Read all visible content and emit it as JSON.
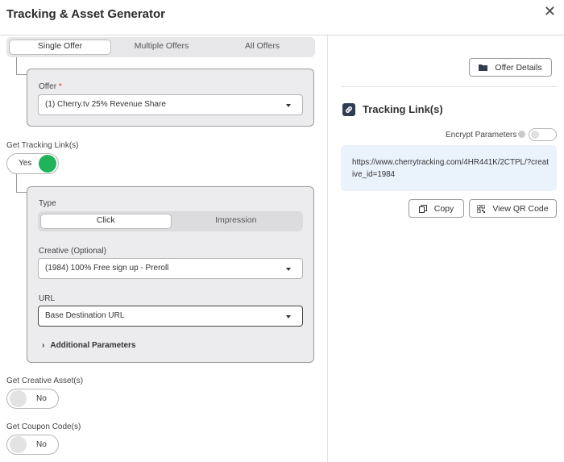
{
  "header": {
    "title": "Tracking & Asset Generator",
    "close_icon": "close-icon"
  },
  "offer_tabs": {
    "items": [
      "Single Offer",
      "Multiple Offers",
      "All Offers"
    ],
    "active": "Single Offer"
  },
  "offer": {
    "label": "Offer",
    "required_mark": "*",
    "value": "(1) Cherry.tv 25% Revenue Share"
  },
  "tracking_links_toggle": {
    "label": "Get Tracking Link(s)",
    "value": "Yes",
    "on": true,
    "color": "#1fb35a"
  },
  "type": {
    "label": "Type",
    "options": [
      "Click",
      "Impression"
    ],
    "active": "Click"
  },
  "creative": {
    "label": "Creative (Optional)",
    "value": "(1984) 100% Free sign up - Preroll"
  },
  "url": {
    "label": "URL",
    "value": "Base Destination URL"
  },
  "additional_params": {
    "label": "Additional Parameters"
  },
  "creative_assets_toggle": {
    "label": "Get Creative Asset(s)",
    "value": "No",
    "on": false
  },
  "coupon_codes_toggle": {
    "label": "Get Coupon Code(s)",
    "value": "No",
    "on": false
  },
  "offer_details_button": {
    "label": "Offer Details",
    "icon": "folder-icon"
  },
  "tracking_links": {
    "heading": "Tracking Link(s)",
    "icon": "link-icon",
    "encrypt_label": "Encrypt Parameters",
    "encrypt_on": false,
    "url": "https://www.cherrytracking.com/4HR441K/2CTPL/?creative_id=1984",
    "copy_label": "Copy",
    "qr_label": "View QR Code"
  }
}
